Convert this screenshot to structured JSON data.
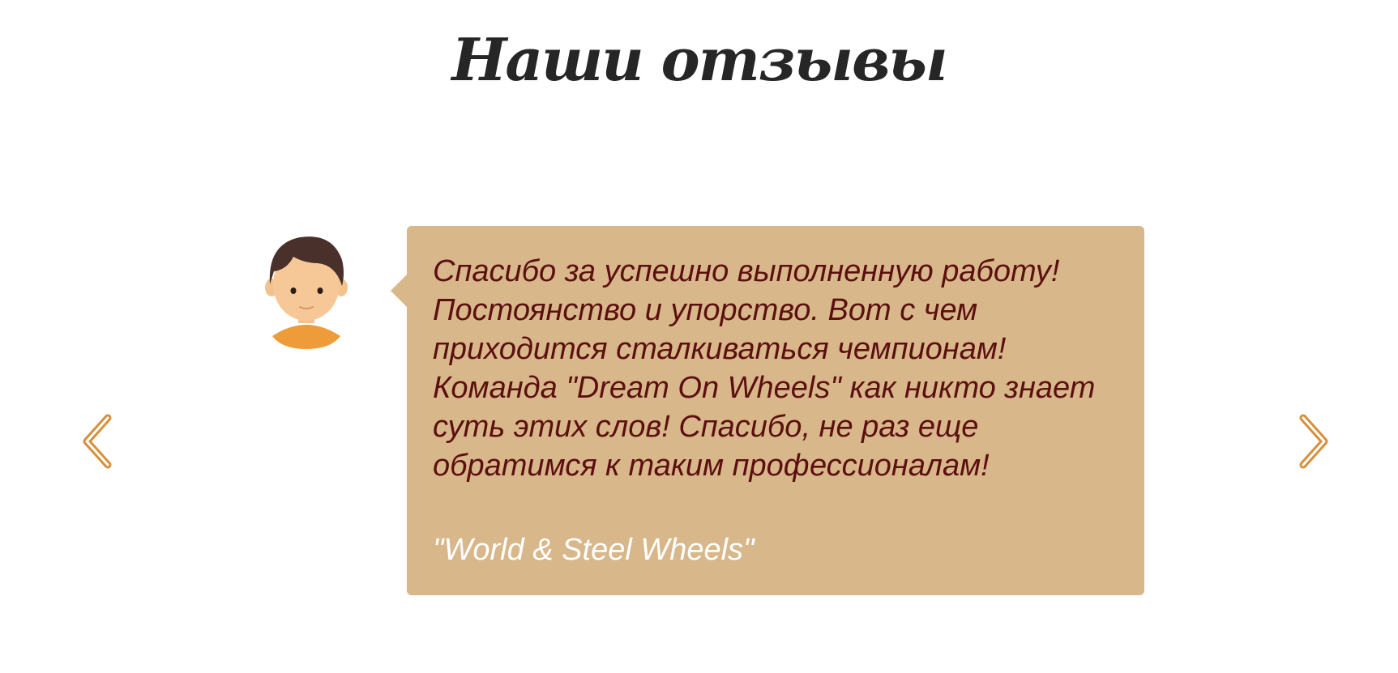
{
  "section": {
    "title": "Наши отзывы"
  },
  "carousel": {
    "prev_icon": "chevron-left-icon",
    "next_icon": "chevron-right-icon",
    "accent_color": "#d68f3a"
  },
  "review": {
    "avatar_icon": "user-avatar-boy",
    "text": "Спасибо за успешно выполненную работу! Постоянство и упорство. Вот с чем приходится сталкиваться чемпионам! Команда \"Dream On Wheels\" как никто знает суть этих слов! Спасибо, не раз еще обратимся к таким профессионалам!",
    "author": "\"World & Steel Wheels\"",
    "card_color": "#d8b78a",
    "text_color": "#5c0f0f"
  }
}
